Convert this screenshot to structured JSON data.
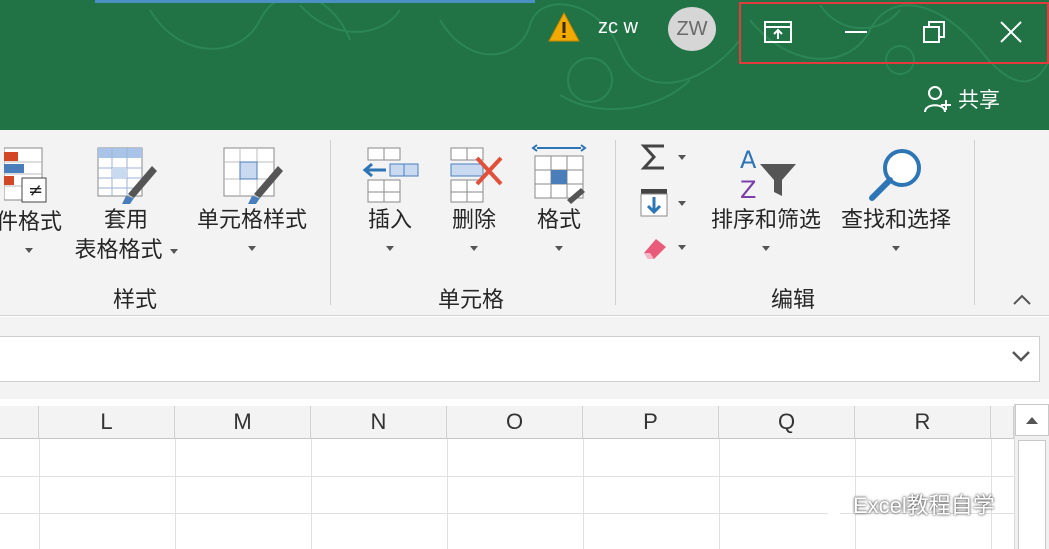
{
  "titlebar": {
    "user_name": "zc w",
    "avatar_initials": "ZW",
    "share_label": "共享",
    "bg_color": "#217346",
    "highlight_color": "#e33b3b"
  },
  "ribbon": {
    "groups": {
      "styles": {
        "label": "样式",
        "conditional_format_partial": "件格式",
        "table_format_line1": "套用",
        "table_format_line2": "表格格式",
        "cell_styles": "单元格样式"
      },
      "cells": {
        "label": "单元格",
        "insert": "插入",
        "delete": "删除",
        "format": "格式"
      },
      "editing": {
        "label": "编辑",
        "sort_filter": "排序和筛选",
        "find_select": "查找和选择"
      }
    }
  },
  "grid": {
    "columns": [
      "L",
      "M",
      "N",
      "O",
      "P",
      "Q",
      "R"
    ]
  },
  "watermark": {
    "text": "Excel教程自学"
  }
}
